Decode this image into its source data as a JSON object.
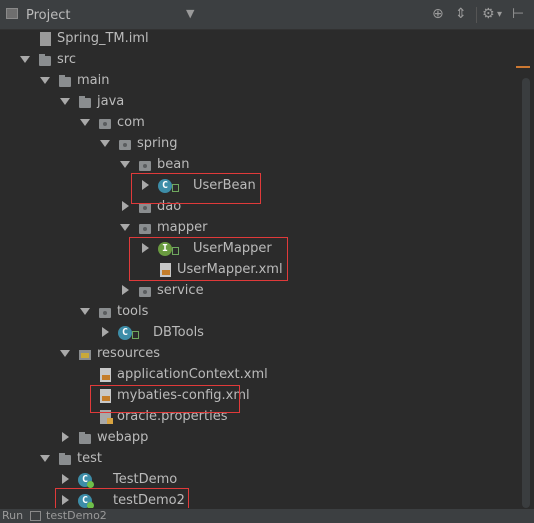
{
  "header": {
    "title": "Project",
    "tools": [
      "globe-icon",
      "collapse-icon",
      "gear-icon",
      "hide-icon"
    ]
  },
  "tree": {
    "spring_tm_iml": "Spring_TM.iml",
    "src": "src",
    "main": "main",
    "java": "java",
    "com": "com",
    "spring": "spring",
    "bean": "bean",
    "userbean": "UserBean",
    "dao": "dao",
    "mapper": "mapper",
    "usermapper": "UserMapper",
    "usermapper_xml": "UserMapper.xml",
    "service": "service",
    "tools": "tools",
    "dbtools": "DBTools",
    "resources": "resources",
    "appctx": "applicationContext.xml",
    "mybatis_config": "mybaties-config.xml",
    "oracle_props": "oracle.properties",
    "webapp": "webapp",
    "test": "test",
    "testdemo": "TestDemo",
    "testdemo2": "testDemo2"
  },
  "status": {
    "run_label": "Run",
    "task": "testDemo2"
  },
  "colors": {
    "background": "#2b2b2b",
    "header": "#3c3f41",
    "highlight": "#e03a3a",
    "class_icon": "#3d8da8",
    "interface_icon": "#6a9b40"
  }
}
